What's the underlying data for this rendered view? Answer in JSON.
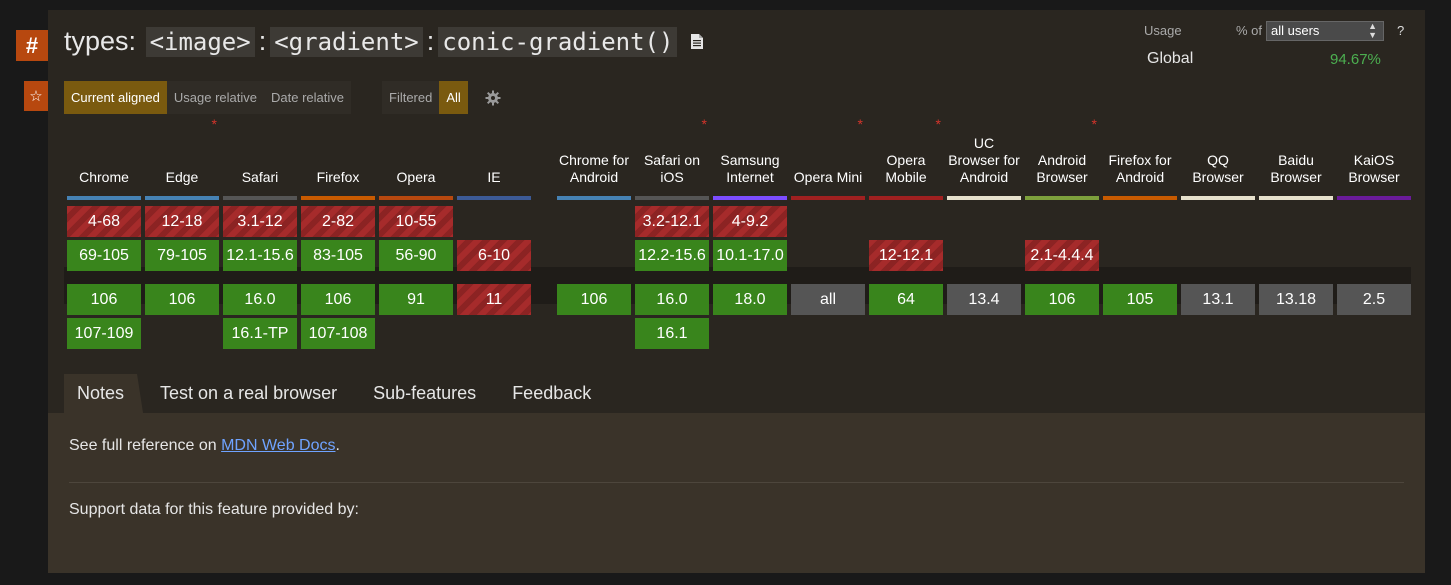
{
  "badges": {
    "hash": "#",
    "star": "☆"
  },
  "title": {
    "prefix": "types:",
    "token1": "<image>",
    "sep1": ":",
    "token2": "<gradient>",
    "sep2": ":",
    "token3": "conic-gradient()"
  },
  "usage": {
    "label": "Usage",
    "pct_of": "% of",
    "users_select": "all users",
    "help": "?",
    "global_label": "Global",
    "global_pct": "94.67%"
  },
  "view_buttons": [
    "Current aligned",
    "Usage relative",
    "Date relative"
  ],
  "filter_buttons": [
    "Filtered",
    "All"
  ],
  "colors": {
    "supported": "#39851c",
    "partial": "#a62b2b",
    "unknown": "#555555",
    "accent": "#7a5a0f"
  },
  "desktop_browsers": [
    {
      "name": "Chrome",
      "asterisk": "",
      "bar": "#4682b4",
      "rows": [
        "4-68",
        "69-105",
        "106",
        "107-109"
      ]
    },
    {
      "name": "Edge",
      "asterisk": "*",
      "bar": "#4682b4",
      "rows": [
        "12-18",
        "79-105",
        "106",
        ""
      ]
    },
    {
      "name": "Safari",
      "asterisk": "",
      "bar": "#555555",
      "rows": [
        "3.1-12",
        "12.1-15.6",
        "16.0",
        "16.1-TP"
      ]
    },
    {
      "name": "Firefox",
      "asterisk": "",
      "bar": "#c85a00",
      "rows": [
        "2-82",
        "83-105",
        "106",
        "107-108"
      ]
    },
    {
      "name": "Opera",
      "asterisk": "",
      "bar": "#b7480f",
      "rows": [
        "10-55",
        "56-90",
        "91",
        ""
      ]
    },
    {
      "name": "IE",
      "asterisk": "",
      "bar": "#3c5a96",
      "rows": [
        "",
        "6-10",
        "11",
        ""
      ]
    }
  ],
  "mobile_browsers": [
    {
      "name": "Chrome for Android",
      "asterisk": "",
      "bar": "#4682b4",
      "rows": [
        "",
        "",
        "106",
        ""
      ]
    },
    {
      "name": "Safari on iOS",
      "asterisk": "*",
      "bar": "#555555",
      "rows": [
        "3.2-12.1",
        "12.2-15.6",
        "16.0",
        "16.1"
      ]
    },
    {
      "name": "Samsung Internet",
      "asterisk": "",
      "bar": "#7c4dff",
      "rows": [
        "4-9.2",
        "10.1-17.0",
        "18.0",
        ""
      ]
    },
    {
      "name": "Opera Mini",
      "asterisk": "*",
      "bar": "#a02020",
      "rows": [
        "",
        "",
        "all",
        ""
      ]
    },
    {
      "name": "Opera Mobile",
      "asterisk": "*",
      "bar": "#a02020",
      "rows": [
        "",
        "12-12.1",
        "64",
        ""
      ]
    },
    {
      "name": "UC Browser for Android",
      "asterisk": "",
      "bar": "#e6e0cc",
      "rows": [
        "",
        "",
        "13.4",
        ""
      ]
    },
    {
      "name": "Android Browser",
      "asterisk": "*",
      "bar": "#7da03c",
      "rows": [
        "",
        "2.1-4.4.4",
        "106",
        ""
      ]
    },
    {
      "name": "Firefox for Android",
      "asterisk": "",
      "bar": "#c85a00",
      "rows": [
        "",
        "",
        "105",
        ""
      ]
    },
    {
      "name": "QQ Browser",
      "asterisk": "",
      "bar": "#e6e0cc",
      "rows": [
        "",
        "",
        "13.1",
        ""
      ]
    },
    {
      "name": "Baidu Browser",
      "asterisk": "",
      "bar": "#e6e0cc",
      "rows": [
        "",
        "",
        "13.18",
        ""
      ]
    },
    {
      "name": "KaiOS Browser",
      "asterisk": "",
      "bar": "#6a1b9a",
      "rows": [
        "",
        "",
        "2.5",
        ""
      ]
    }
  ],
  "tabs": [
    "Notes",
    "Test on a real browser",
    "Sub-features",
    "Feedback"
  ],
  "notes": {
    "prefix": "See full reference on ",
    "link": "MDN Web Docs",
    "suffix": ".",
    "support": "Support data for this feature provided by:"
  }
}
